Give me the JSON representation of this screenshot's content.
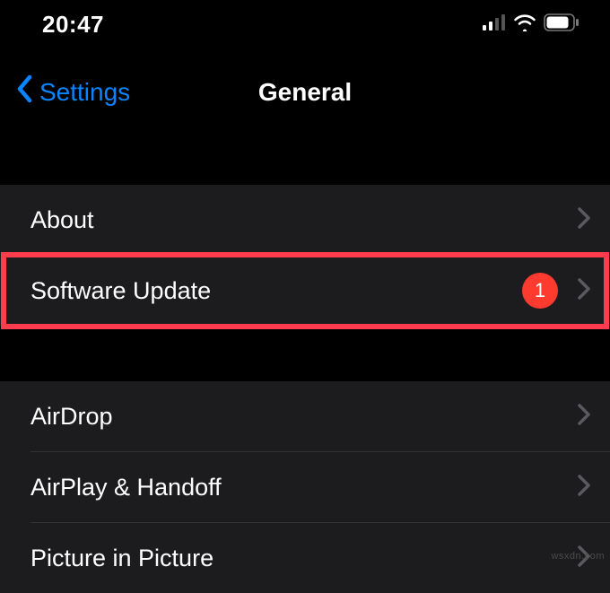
{
  "statusBar": {
    "time": "20:47"
  },
  "nav": {
    "backLabel": "Settings",
    "title": "General"
  },
  "group1": {
    "items": [
      {
        "label": "About"
      },
      {
        "label": "Software Update",
        "badge": "1"
      }
    ]
  },
  "group2": {
    "items": [
      {
        "label": "AirDrop"
      },
      {
        "label": "AirPlay & Handoff"
      },
      {
        "label": "Picture in Picture"
      }
    ]
  },
  "watermark": "wsxdn.com"
}
